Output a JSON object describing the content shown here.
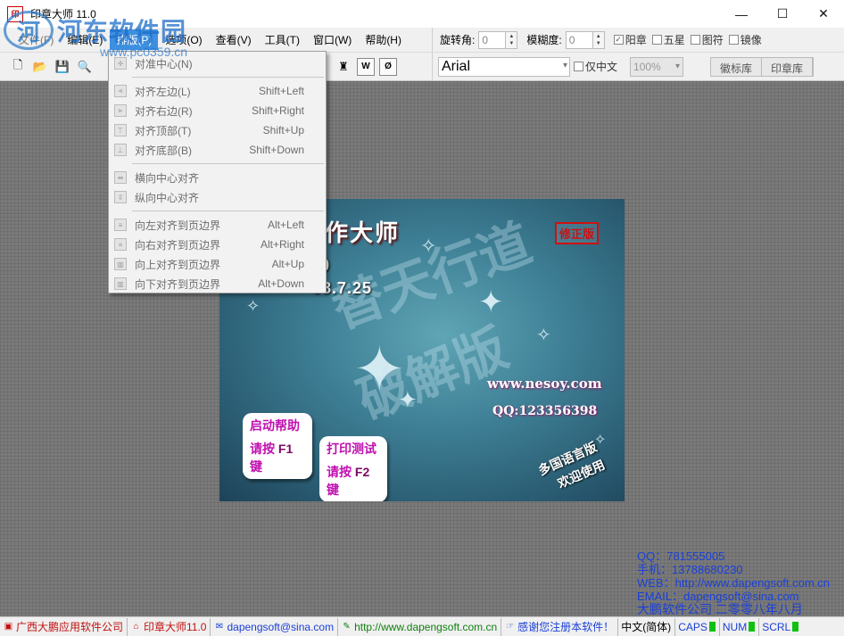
{
  "window": {
    "title": "印章大师 11.0",
    "app_icon": "印",
    "controls": {
      "minimize": "—",
      "maximize": "☐",
      "close": "✕"
    }
  },
  "menubar": {
    "items": [
      {
        "label": "文件(F)"
      },
      {
        "label": "编辑(E)"
      },
      {
        "label": "排版(P)"
      },
      {
        "label": "选项(O)"
      },
      {
        "label": "查看(V)"
      },
      {
        "label": "工具(T)"
      },
      {
        "label": "窗口(W)"
      },
      {
        "label": "帮助(H)"
      }
    ]
  },
  "rotbar": {
    "rotate_label": "旋转角:",
    "rotate_value": "0",
    "blur_label": "模糊度:",
    "blur_value": "0",
    "checkboxes": [
      {
        "label": "阳章",
        "checked": true
      },
      {
        "label": "五星",
        "checked": false
      },
      {
        "label": "图符",
        "checked": false
      },
      {
        "label": "镜像",
        "checked": false
      }
    ]
  },
  "fontbar": {
    "font": "Arial",
    "chinese_only_label": "仅中文",
    "zoom": "100%",
    "tabs": [
      "徽标库",
      "印章库"
    ]
  },
  "dropdown": {
    "items": [
      {
        "label": "对准中心(N)",
        "shortcut": ""
      },
      {
        "label": "对齐左边(L)",
        "shortcut": "Shift+Left"
      },
      {
        "label": "对齐右边(R)",
        "shortcut": "Shift+Right"
      },
      {
        "label": "对齐顶部(T)",
        "shortcut": "Shift+Up"
      },
      {
        "label": "对齐底部(B)",
        "shortcut": "Shift+Down"
      },
      {
        "label": "横向中心对齐",
        "shortcut": ""
      },
      {
        "label": "纵向中心对齐",
        "shortcut": ""
      },
      {
        "label": "向左对齐到页边界",
        "shortcut": "Alt+Left"
      },
      {
        "label": "向右对齐到页边界",
        "shortcut": "Alt+Right"
      },
      {
        "label": "向上对齐到页边界",
        "shortcut": "Alt+Up"
      },
      {
        "label": "向下对齐到页边界",
        "shortcut": "Alt+Down"
      }
    ]
  },
  "splash": {
    "title": "作大师",
    "version_fragment": "0",
    "date_fragment": "08.7.25",
    "badge": "修正版",
    "watermark": [
      "替天行道",
      "破解版"
    ],
    "url": "www.nesoy.com",
    "qq": "QQ:123356398",
    "help_button": {
      "line1": "启动帮助",
      "line2_prefix": "请按",
      "line2_key": "F1",
      "line2_suffix": "键"
    },
    "print_button": {
      "line1": "打印测试",
      "line2_prefix": "请按",
      "line2_key": "F2",
      "line2_suffix": "键"
    },
    "lang_line1": "多国语言版",
    "lang_line2": "欢迎使用"
  },
  "contact": {
    "qq": "QQ：781555005",
    "phone": "手机：13788680230",
    "web": "WEB：http://www.dapengsoft.com.cn",
    "email": "EMAIL：dapengsoft@sina.com",
    "company": "大鹏软件公司  二零零八年八月"
  },
  "site_watermark": {
    "logo": "河",
    "name": "河东软件园",
    "url": "www.pc0359.cn"
  },
  "statusbar": {
    "company": "广西大鹏应用软件公司",
    "product": "印章大师11.0",
    "email": "dapengsoft@sina.com",
    "web": "http://www.dapengsoft.com.cn",
    "thanks": "感谢您注册本软件！",
    "ime": "中文(简体)",
    "caps": "CAPS",
    "num": "NUM",
    "scrl": "SCRL"
  }
}
